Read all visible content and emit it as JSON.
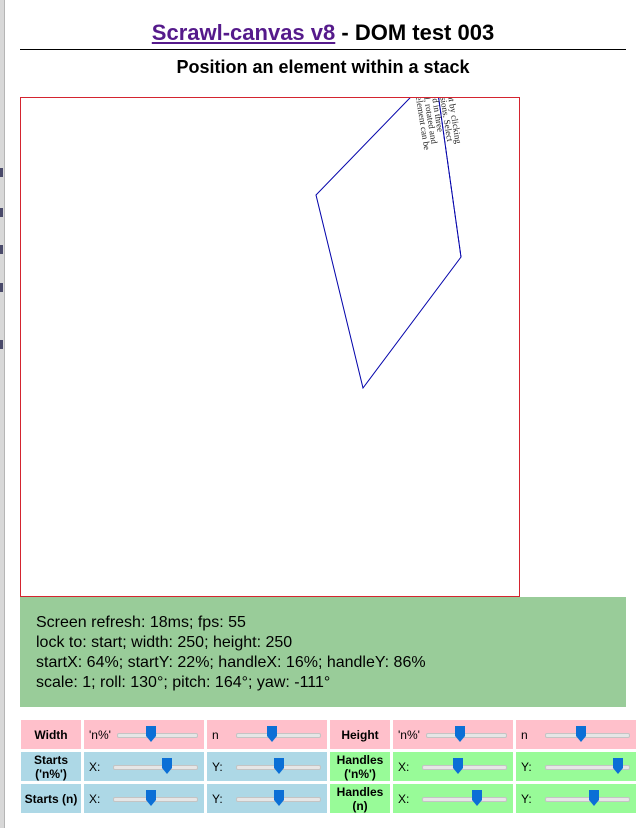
{
  "header": {
    "link_text": "Scrawl-canvas v8",
    "title_suffix": " - DOM test 003",
    "subtitle": "Position an element within a stack"
  },
  "stage": {
    "element_text_lines": [
      "This element can be",
      "scaled, rotated and",
      "skewed in three",
      "dimensions. Select",
      "element by clicking"
    ],
    "border_color": "#d4242f",
    "outline_color": "#0000aa"
  },
  "report": {
    "line1": "Screen refresh: 18ms; fps: 55",
    "line2": "lock to: start; width: 250; height: 250",
    "line3": "startX: 64%; startY: 22%; handleX: 16%; handleY: 86%",
    "line4": "scale: 1; roll: 130°; pitch: 164°; yaw: -111°"
  },
  "controls": {
    "width": {
      "label": "Width",
      "percent_label": "'n%'",
      "percent_value": 0.42,
      "abs_label": "n",
      "abs_value": 0.42
    },
    "height": {
      "label": "Height",
      "percent_label": "'n%'",
      "percent_value": 0.42,
      "abs_label": "n",
      "abs_value": 0.42
    },
    "starts_pct": {
      "label": "Starts ('n%')",
      "x_label": "X:",
      "x_value": 0.64,
      "y_label": "Y:",
      "y_value": 0.5
    },
    "handles_pct": {
      "label": "Handles ('n%')",
      "x_label": "X:",
      "x_value": 0.42,
      "y_label": "Y:",
      "y_value": 0.86
    },
    "starts_n": {
      "label": "Starts (n)",
      "x_label": "X:",
      "x_value": 0.45,
      "y_label": "Y:",
      "y_value": 0.5
    },
    "handles_n": {
      "label": "Handles (n)",
      "x_label": "X:",
      "x_value": 0.65,
      "y_label": "Y:",
      "y_value": 0.58
    }
  },
  "colors": {
    "accent": "#0b6fd6",
    "report_bg": "#99cc99",
    "pink": "#ffc0cb",
    "blue": "#add8e6",
    "green": "#98fb98"
  }
}
